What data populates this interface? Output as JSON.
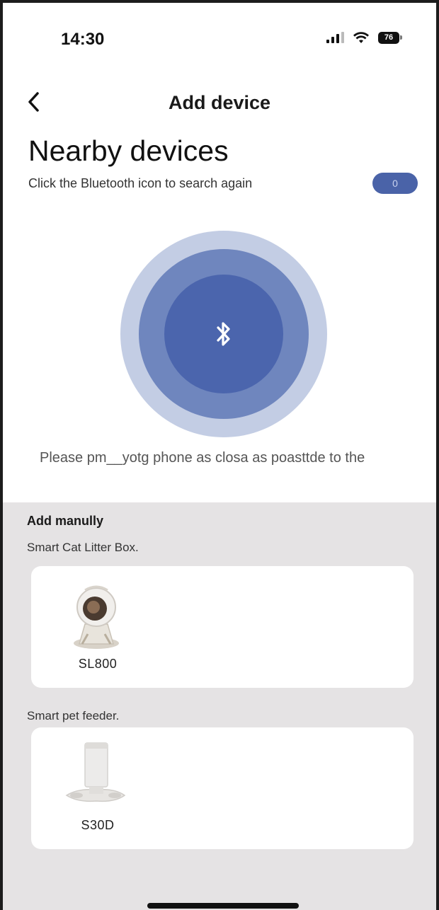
{
  "status_bar": {
    "time": "14:30",
    "battery_level": "76",
    "icons": [
      "signal-icon",
      "wifi-icon",
      "battery-icon"
    ]
  },
  "nav": {
    "back_icon": "chevron-left-icon",
    "title": "Add device"
  },
  "nearby": {
    "title": "Nearby devices",
    "subtitle": "Click the Bluetooth icon to search again",
    "toggle_text": "0",
    "radar_icon": "bluetooth-icon",
    "hint": "Please pm__yotg phone as closa as poasttde to the"
  },
  "manual": {
    "title": "Add manully",
    "categories": [
      {
        "label": "Smart Cat Litter Box.",
        "device": {
          "name": "SL800",
          "icon": "cat-litter-box-image"
        }
      },
      {
        "label": "Smart pet feeder.",
        "device": {
          "name": "S30D",
          "icon": "pet-feeder-image"
        }
      }
    ]
  },
  "colors": {
    "accent": "#4a63a8",
    "radar_outer": "#c3cde4",
    "radar_mid": "#6f86be",
    "radar_inner": "#4b65ad",
    "section_bg": "#e5e3e4"
  }
}
